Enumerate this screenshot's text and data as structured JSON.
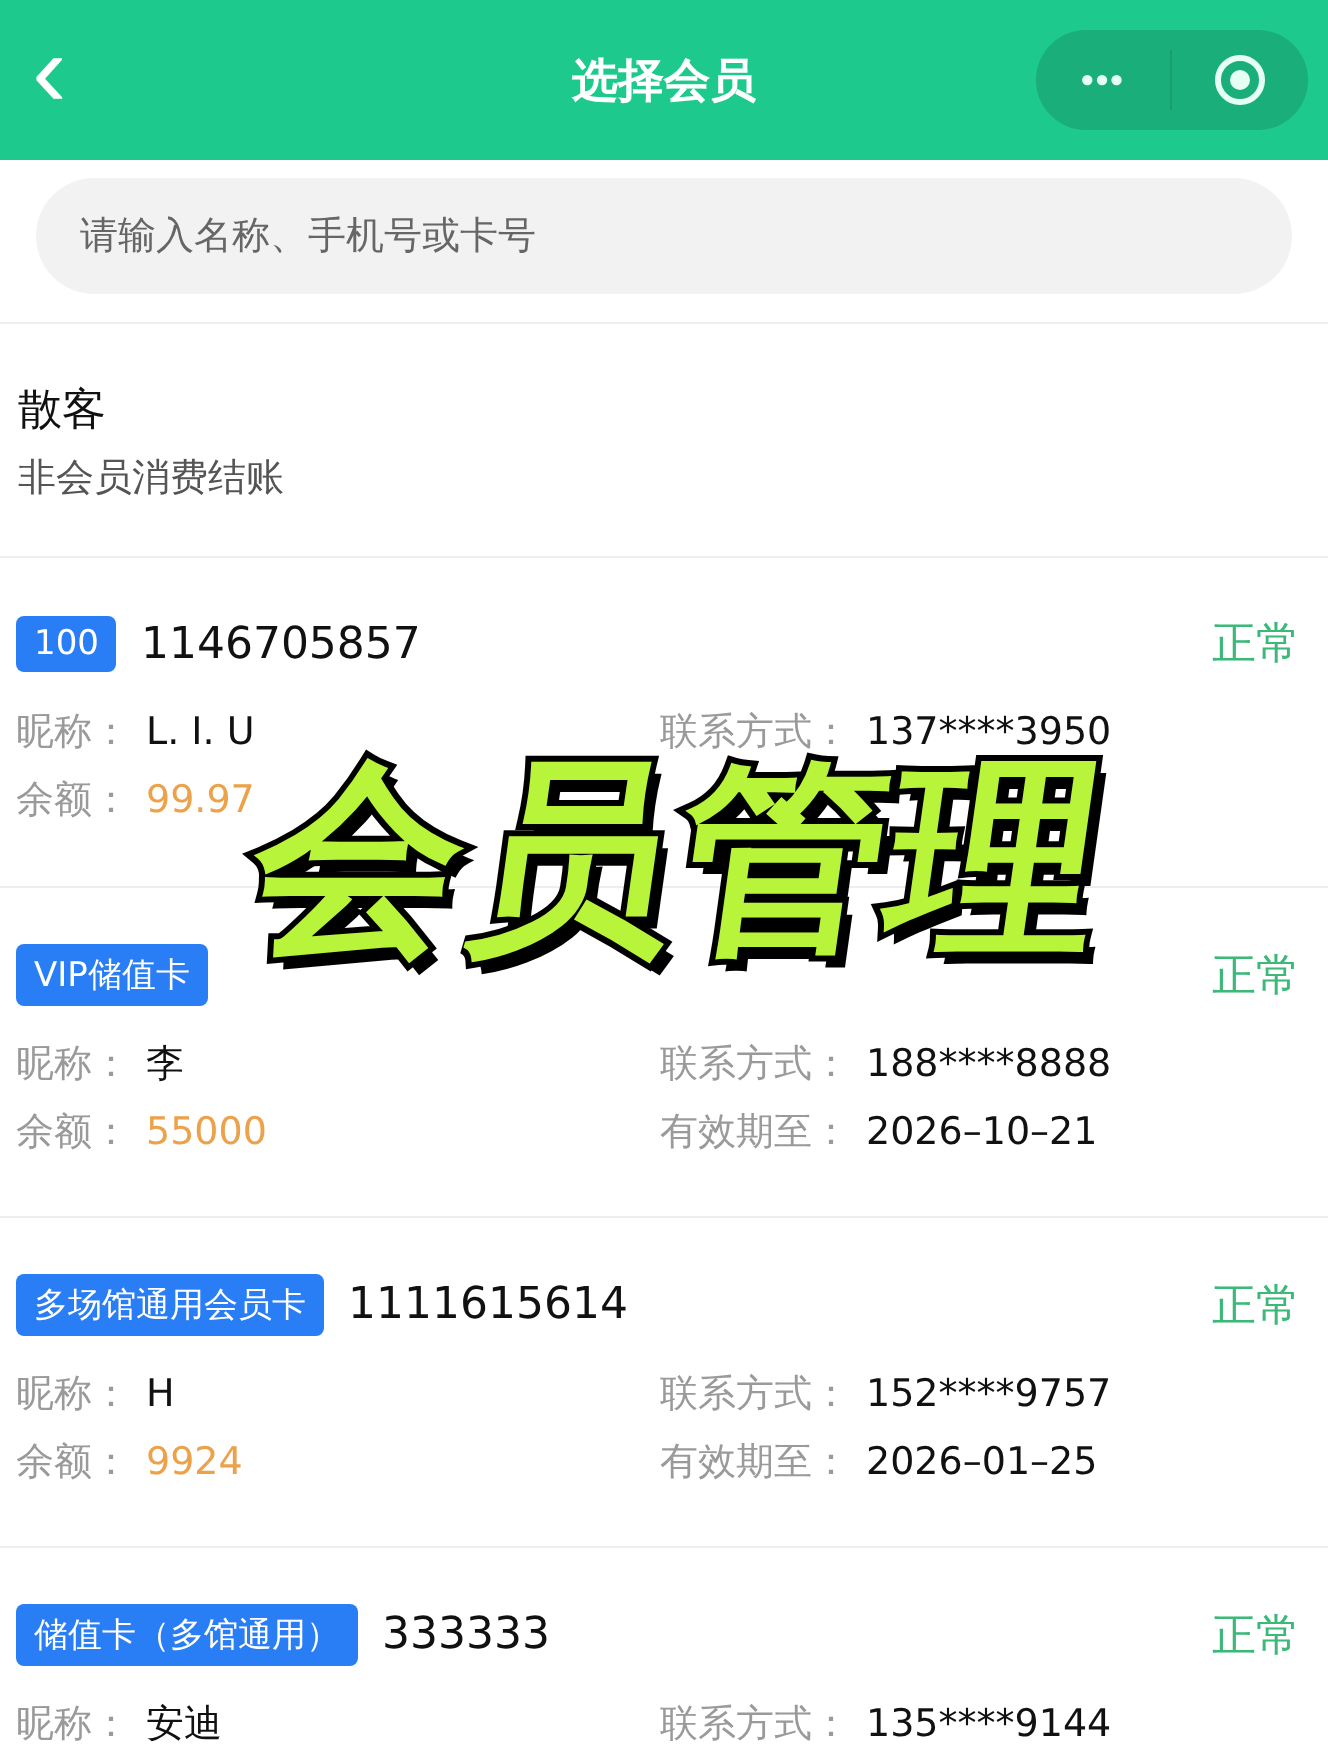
{
  "header": {
    "back": "‹",
    "title": "选择会员",
    "more": "•••"
  },
  "search": {
    "placeholder": "请输入名称、手机号或卡号"
  },
  "walk_in": {
    "title": "散客",
    "subtitle": "非会员消费结账"
  },
  "members": [
    {
      "badge": "100",
      "card_no": "1146705857",
      "status": "正常",
      "nickname_label": "昵称：",
      "nickname": "L. I. U",
      "balance_label": "余额：",
      "balance": "99.97",
      "phone_label": "联系方式：",
      "phone": "137****3950"
    },
    {
      "badge": "VIP储值卡",
      "status": "正常",
      "nickname_label": "昵称：",
      "nickname": "李",
      "balance_label": "余额：",
      "balance": "55000",
      "phone_label": "联系方式：",
      "phone": "188****8888",
      "expiry_label": "有效期至：",
      "expiry": "2026–10–21"
    },
    {
      "badge": "多场馆通用会员卡",
      "card_no": "1111615614",
      "status": "正常",
      "nickname_label": "昵称：",
      "nickname": "H",
      "balance_label": "余额：",
      "balance": "9924",
      "phone_label": "联系方式：",
      "phone": "152****9757",
      "expiry_label": "有效期至：",
      "expiry": "2026–01–25"
    },
    {
      "badge": "储值卡（多馆通用）",
      "card_no": "333333",
      "status": "正常",
      "nickname_label": "昵称：",
      "nickname": "安迪",
      "phone_label": "联系方式：",
      "phone": "135****9144"
    }
  ],
  "overlay": {
    "text": "会员管理"
  }
}
